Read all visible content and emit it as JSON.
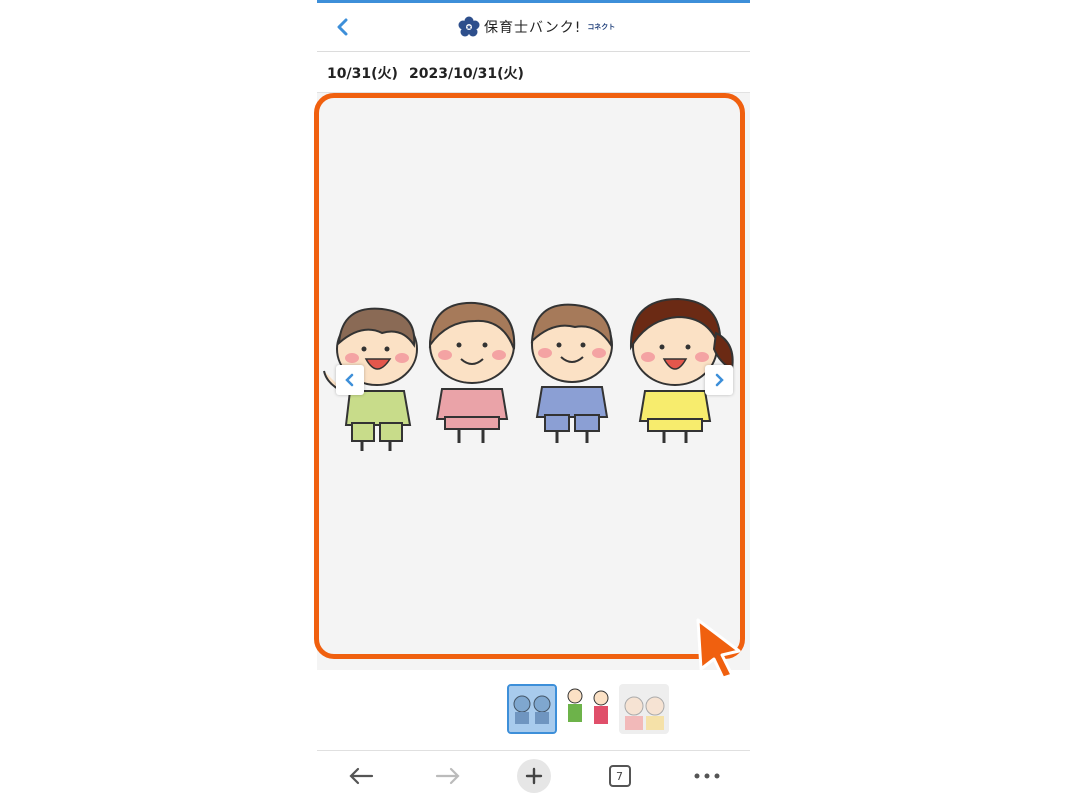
{
  "header": {
    "brand_name": "保育士バンク!",
    "brand_sub": "コネクト",
    "back_icon": "chevron-left-icon"
  },
  "datebar": {
    "short_date": "10/31(火)",
    "full_date": "2023/10/31(火)"
  },
  "viewer": {
    "prev_icon": "chevron-left-icon",
    "next_icon": "chevron-right-icon",
    "image_subject": "four children holding hands illustration"
  },
  "thumbnails": [
    {
      "name": "thumbnail-children-holding-hands",
      "selected": true
    },
    {
      "name": "thumbnail-two-kids",
      "selected": false
    },
    {
      "name": "thumbnail-faded-kids",
      "selected": false
    }
  ],
  "bottom_nav": {
    "tab_count": "7"
  },
  "colors": {
    "accent": "#3d8fd9",
    "highlight": "#f0600f",
    "viewer_bg": "#f4f4f4"
  }
}
